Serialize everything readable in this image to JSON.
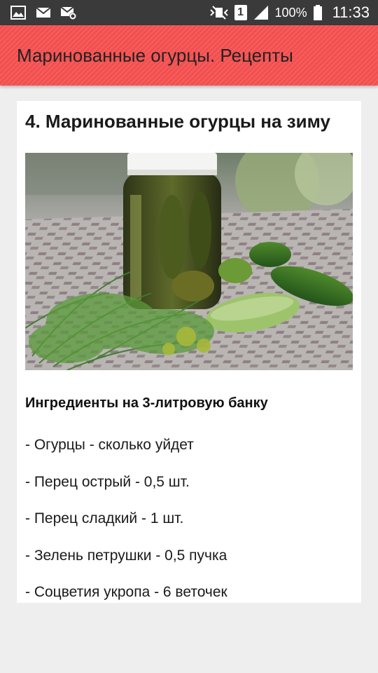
{
  "status_bar": {
    "icons_left": [
      "image-icon",
      "mail-icon",
      "mail-settings-icon"
    ],
    "sim_slot": "1",
    "battery_percent": "100%",
    "time": "11:33"
  },
  "app_bar": {
    "title": "Маринованные огурцы. Рецепты"
  },
  "article": {
    "title": "4. Маринованные огурцы на зиму",
    "ingredients_heading": "Ингредиенты на 3-литровую банку",
    "ingredients": [
      "- Огурцы - сколько уйдет",
      "- Перец острый - 0,5 шт.",
      "- Перец сладкий - 1 шт.",
      "- Зелень петрушки - 0,5 пучка",
      "- Соцветия укропа - 6 веточек"
    ]
  },
  "colors": {
    "status_bar": "#3a3a3a",
    "app_bar": "#f85252",
    "background": "#eeeeee",
    "card": "#ffffff"
  }
}
